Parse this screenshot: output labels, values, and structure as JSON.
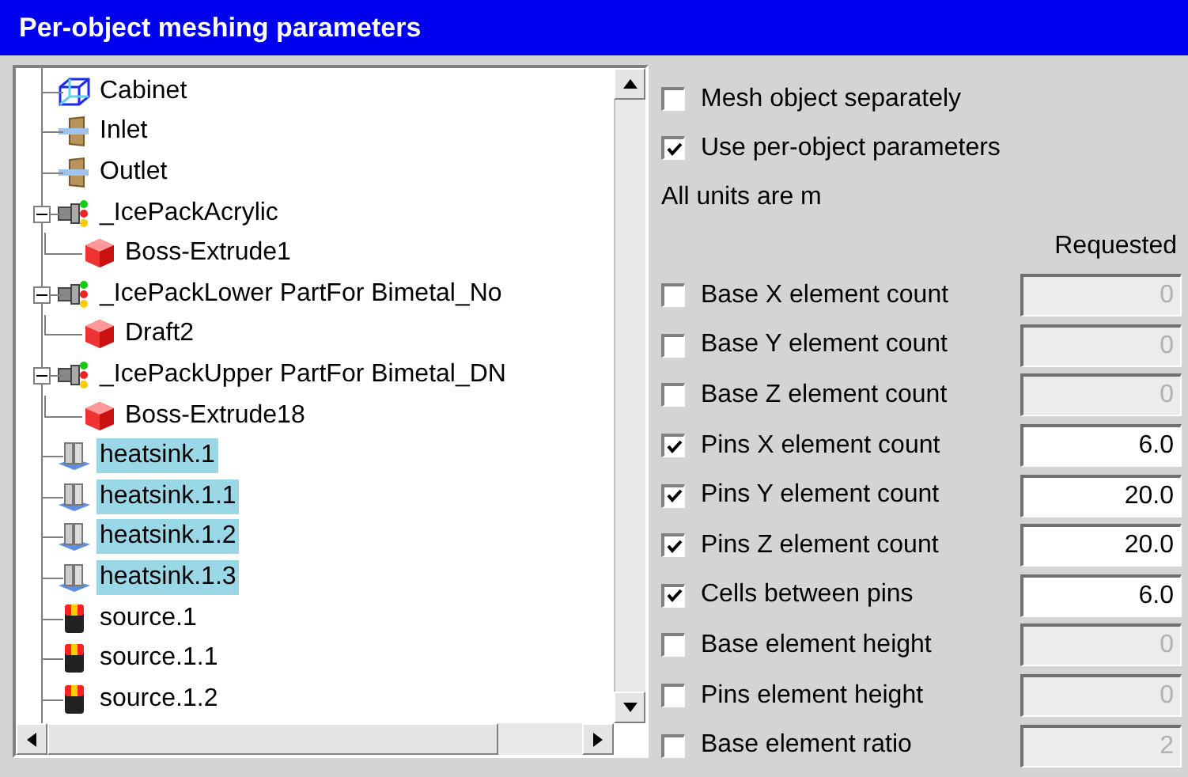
{
  "window": {
    "title": "Per-object meshing parameters"
  },
  "tree": [
    {
      "label": "Cabinet",
      "kind": "cabinet",
      "selected": false
    },
    {
      "label": "Inlet",
      "kind": "vent",
      "selected": false
    },
    {
      "label": "Outlet",
      "kind": "vent",
      "selected": false
    },
    {
      "label": "_IcePackAcrylic",
      "kind": "assembly",
      "selected": false,
      "expanded": true,
      "children": [
        {
          "label": "Boss-Extrude1",
          "kind": "block",
          "selected": false
        }
      ]
    },
    {
      "label": "_IcePackLower PartFor Bimetal_No",
      "kind": "assembly",
      "selected": false,
      "expanded": true,
      "children": [
        {
          "label": "Draft2",
          "kind": "block",
          "selected": false
        }
      ]
    },
    {
      "label": "_IcePackUpper PartFor Bimetal_DN",
      "kind": "assembly",
      "selected": false,
      "expanded": true,
      "children": [
        {
          "label": "Boss-Extrude18",
          "kind": "block",
          "selected": false
        }
      ]
    },
    {
      "label": "heatsink.1",
      "kind": "heatsink",
      "selected": true
    },
    {
      "label": "heatsink.1.1",
      "kind": "heatsink",
      "selected": true
    },
    {
      "label": "heatsink.1.2",
      "kind": "heatsink",
      "selected": true
    },
    {
      "label": "heatsink.1.3",
      "kind": "heatsink",
      "selected": true
    },
    {
      "label": "source.1",
      "kind": "source",
      "selected": false
    },
    {
      "label": "source.1.1",
      "kind": "source",
      "selected": false
    },
    {
      "label": "source.1.2",
      "kind": "source",
      "selected": false
    }
  ],
  "options": [
    {
      "label": "Mesh object separately",
      "checked": false
    },
    {
      "label": "Use per-object parameters",
      "checked": true
    }
  ],
  "units_note": "All units are m",
  "column_header": "Requested",
  "parameters": [
    {
      "label": "Base X element count",
      "checked": false,
      "value": "0"
    },
    {
      "label": "Base Y element count",
      "checked": false,
      "value": "0"
    },
    {
      "label": "Base Z element count",
      "checked": false,
      "value": "0"
    },
    {
      "label": "Pins X element count",
      "checked": true,
      "value": "6.0"
    },
    {
      "label": "Pins Y element count",
      "checked": true,
      "value": "20.0"
    },
    {
      "label": "Pins Z element count",
      "checked": true,
      "value": "20.0"
    },
    {
      "label": "Cells between pins",
      "checked": true,
      "value": "6.0"
    },
    {
      "label": "Base element height",
      "checked": false,
      "value": "0"
    },
    {
      "label": "Pins element height",
      "checked": false,
      "value": "0"
    },
    {
      "label": "Base element ratio",
      "checked": false,
      "value": "2"
    }
  ]
}
